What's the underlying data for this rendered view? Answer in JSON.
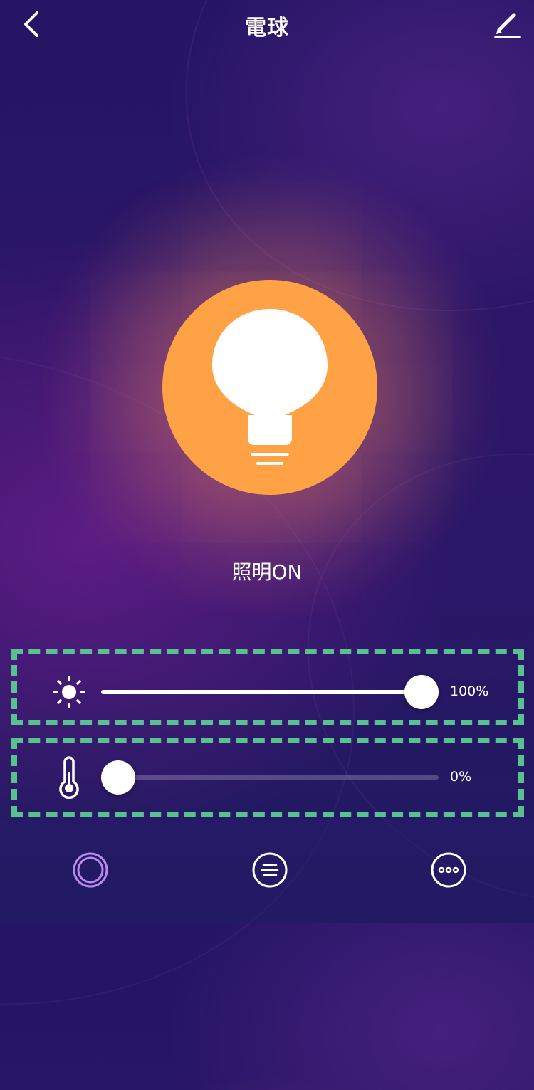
{
  "header": {
    "title": "電球",
    "back_icon": "chevron-left-icon",
    "edit_icon": "pencil-icon"
  },
  "device": {
    "icon": "lightbulb-icon",
    "status": "照明ON",
    "accent_color": "#ffa245"
  },
  "controls": {
    "brightness": {
      "icon": "sun-icon",
      "value": 1.0,
      "value_label": "100%"
    },
    "color_temperature": {
      "icon": "thermometer-icon",
      "value": 0.0,
      "value_label": "0%"
    },
    "highlight_color": "#57c18f"
  },
  "bottom_nav": {
    "items": [
      {
        "icon": "ring-icon",
        "active": true,
        "color": "#b98ae8"
      },
      {
        "icon": "list-icon",
        "active": false,
        "color": "#ffffff"
      },
      {
        "icon": "more-icon",
        "active": false,
        "color": "#ffffff"
      }
    ]
  }
}
